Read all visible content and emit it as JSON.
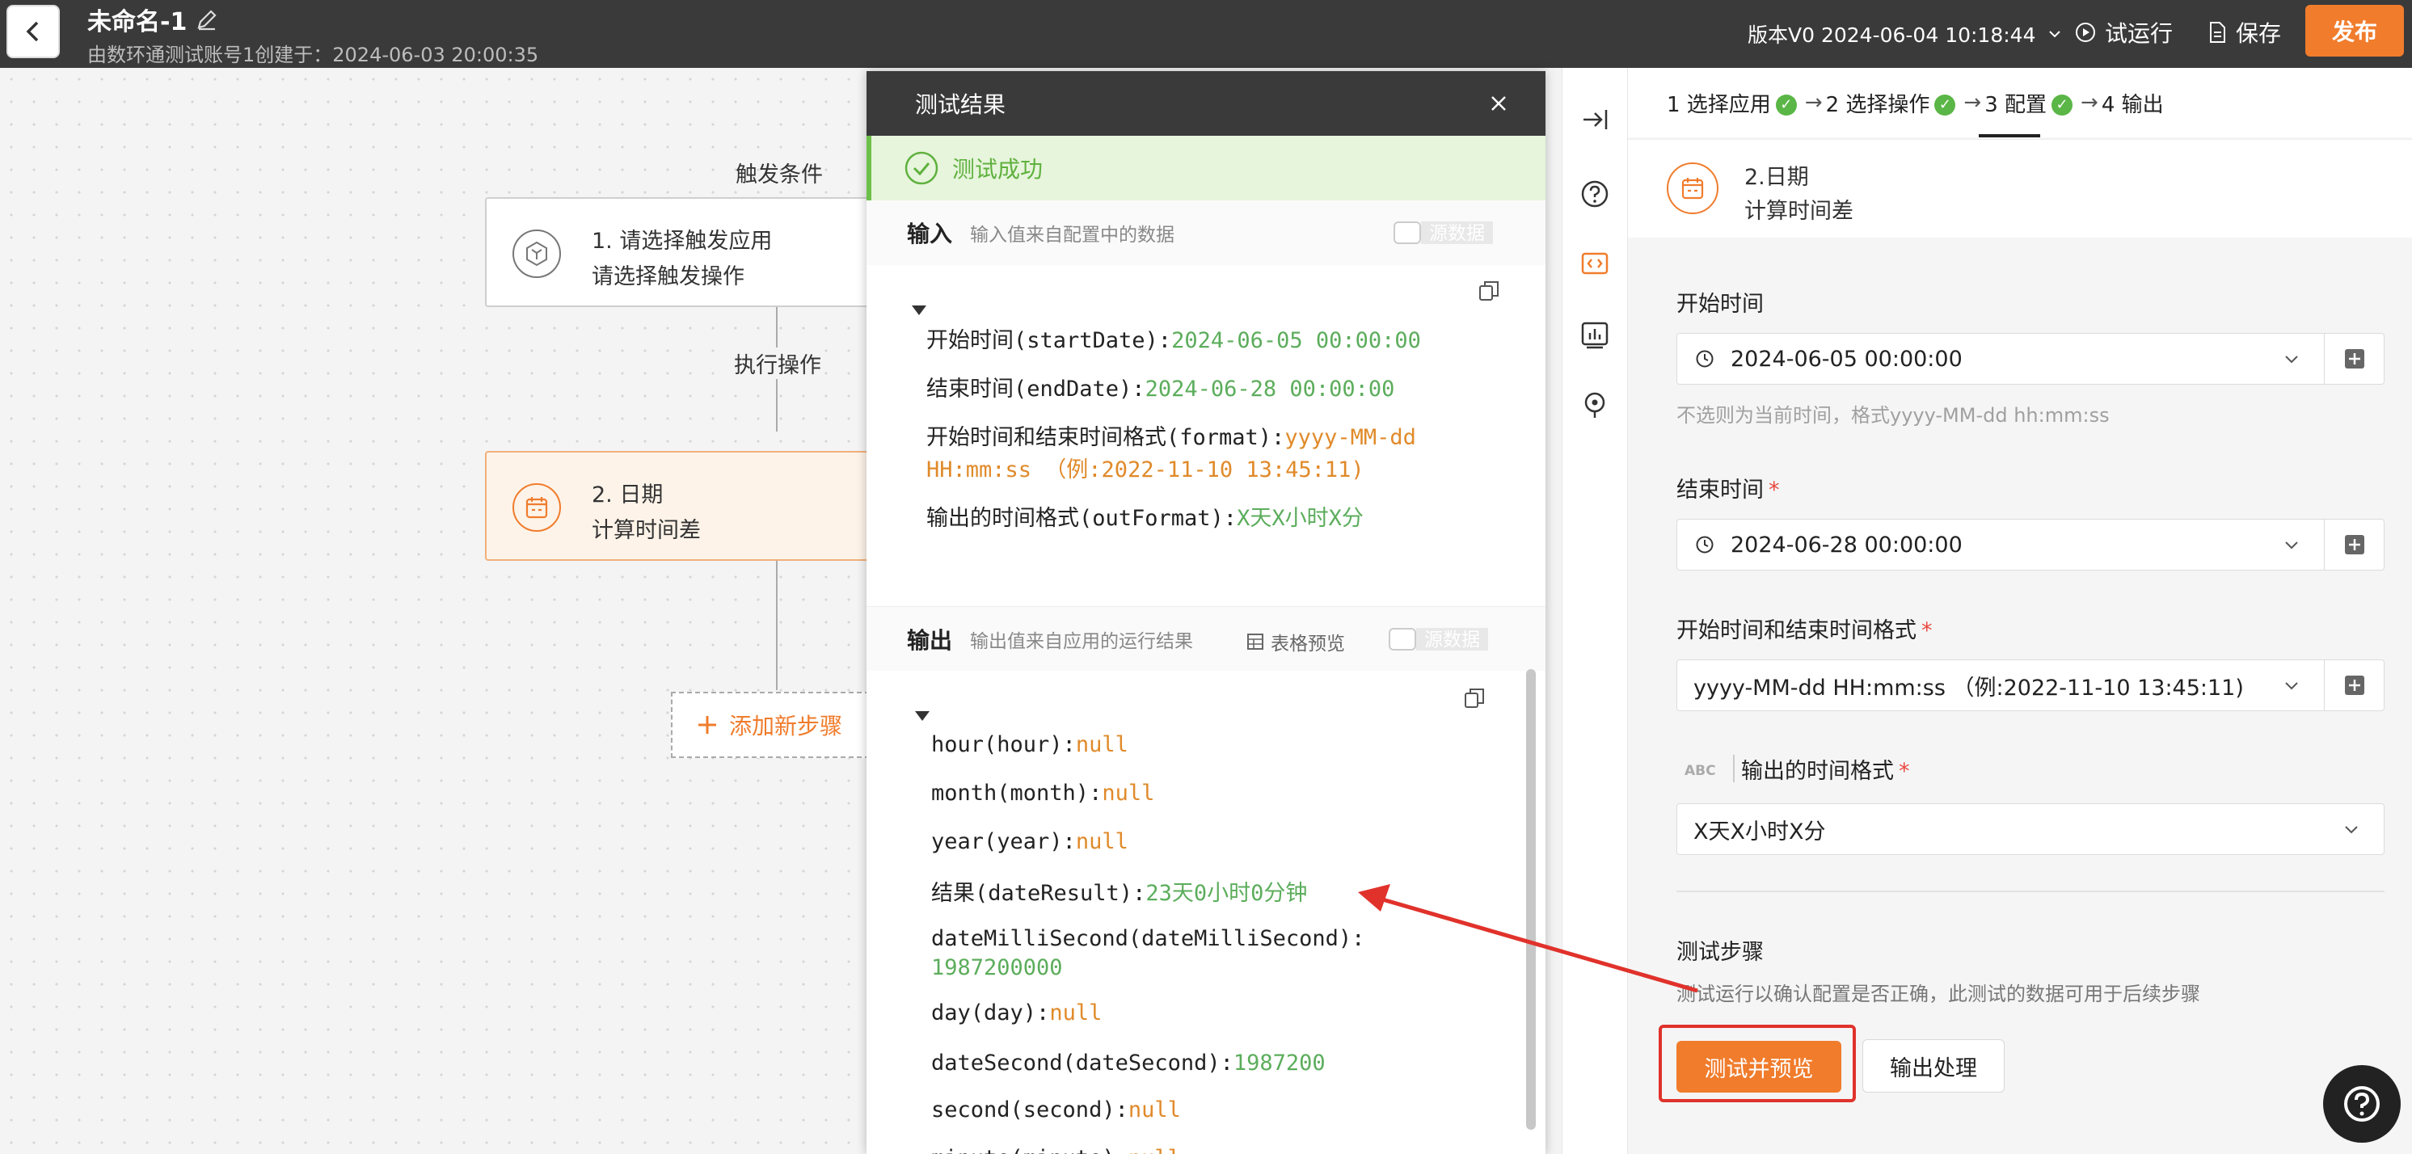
{
  "header": {
    "title": "未命名-1",
    "subtitle": "由数环通测试账号1创建于：2024-06-03 20:00:35",
    "version": "版本V0 2024-06-04 10:18:44",
    "run_label": "试运行",
    "save_label": "保存",
    "publish_label": "发布"
  },
  "canvas": {
    "trigger_label": "触发条件",
    "exec_label": "执行操作",
    "node1": {
      "line1": "1. 请选择触发应用",
      "line2": "请选择触发操作"
    },
    "node2": {
      "line1": "2. 日期",
      "line2": "计算时间差"
    },
    "add_step": "添加新步骤"
  },
  "result": {
    "title": "测试结果",
    "success": "测试成功",
    "input_title": "输入",
    "input_sub": "输入值来自配置中的数据",
    "raw_label": "源数据",
    "input_rows": [
      {
        "key": "开始时间(startDate):",
        "value": "2024-06-05 00:00:00",
        "color": "green"
      },
      {
        "key": "结束时间(endDate):",
        "value": "2024-06-28 00:00:00",
        "color": "green"
      },
      {
        "key": "开始时间和结束时间格式(format):",
        "value": "yyyy-MM-dd",
        "color": "orange"
      },
      {
        "key": "",
        "value": "HH:mm:ss （例:2022-11-10 13:45:11)",
        "color": "orange"
      },
      {
        "key": "输出的时间格式(outFormat):",
        "value": "X天X小时X分",
        "color": "green"
      }
    ],
    "output_title": "输出",
    "output_sub": "输出值来自应用的运行结果",
    "table_preview": "表格预览",
    "output_rows": [
      {
        "key": "hour(hour):",
        "value": "null",
        "color": "orange"
      },
      {
        "key": "month(month):",
        "value": "null",
        "color": "orange"
      },
      {
        "key": "year(year):",
        "value": "null",
        "color": "orange"
      },
      {
        "key": "结果(dateResult):",
        "value": "23天0小时0分钟",
        "color": "green"
      },
      {
        "key": "dateMilliSecond(dateMilliSecond):",
        "value": "",
        "color": "green"
      },
      {
        "key": "",
        "value": "1987200000",
        "color": "green"
      },
      {
        "key": "day(day):",
        "value": "null",
        "color": "orange"
      },
      {
        "key": "dateSecond(dateSecond):",
        "value": "1987200",
        "color": "green"
      },
      {
        "key": "second(second):",
        "value": "null",
        "color": "orange"
      },
      {
        "key": "minute(minute):",
        "value": "null",
        "color": "orange"
      }
    ]
  },
  "config": {
    "steps": [
      {
        "label": "1 选择应用",
        "done": true
      },
      {
        "label": "2 选择操作",
        "done": true
      },
      {
        "label": "3 配置",
        "done": true
      },
      {
        "label": "4 输出",
        "done": false
      }
    ],
    "app_line1": "2.日期",
    "app_line2": "计算时间差",
    "start_label": "开始时间",
    "start_value": "2024-06-05 00:00:00",
    "start_hint": "不选则为当前时间，格式yyyy-MM-dd hh:mm:ss",
    "end_label": "结束时间",
    "end_value": "2024-06-28 00:00:00",
    "format_label": "开始时间和结束时间格式",
    "format_value": "yyyy-MM-dd HH:mm:ss （例:2022-11-10 13:45:11)",
    "abc": "ABC",
    "out_label": "输出的时间格式",
    "out_value": "X天X小时X分",
    "test_title": "测试步骤",
    "test_hint": "测试运行以确认配置是否正确，此测试的数据可用于后续步骤",
    "test_btn": "测试并预览",
    "output_btn": "输出处理"
  },
  "colors": {
    "accent": "#f07c2c",
    "success": "#5ab646",
    "annotation": "#e0322b"
  }
}
